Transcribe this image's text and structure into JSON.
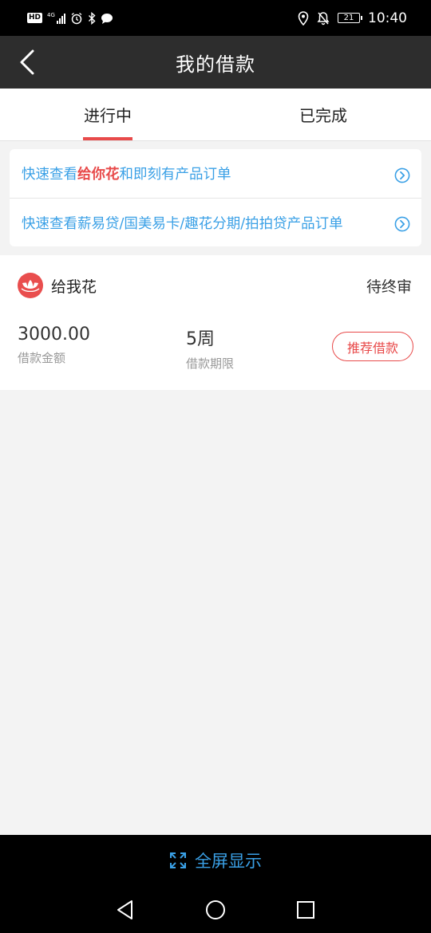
{
  "status_bar": {
    "hd": "HD",
    "network": "4G",
    "battery": "21",
    "time": "10:40"
  },
  "header": {
    "title": "我的借款"
  },
  "tabs": [
    {
      "label": "进行中",
      "active": true
    },
    {
      "label": "已完成",
      "active": false
    }
  ],
  "quick_links": [
    {
      "prefix": "快速查看",
      "highlight": "给你花",
      "suffix": "和即刻有产品订单"
    },
    {
      "prefix": "快速查看薪易贷/国美易卡/趣花分期/拍拍贷产品订单",
      "highlight": "",
      "suffix": ""
    }
  ],
  "loan": {
    "product_name": "给我花",
    "status": "待终审",
    "amount_value": "3000.00",
    "amount_label": "借款金额",
    "term_value": "5周",
    "term_label": "借款期限",
    "button_label": "推荐借款"
  },
  "fullscreen": {
    "label": "全屏显示"
  },
  "colors": {
    "accent_red": "#e84a4a",
    "link_blue": "#3aa0e6",
    "header_bg": "#2d2d2d"
  }
}
